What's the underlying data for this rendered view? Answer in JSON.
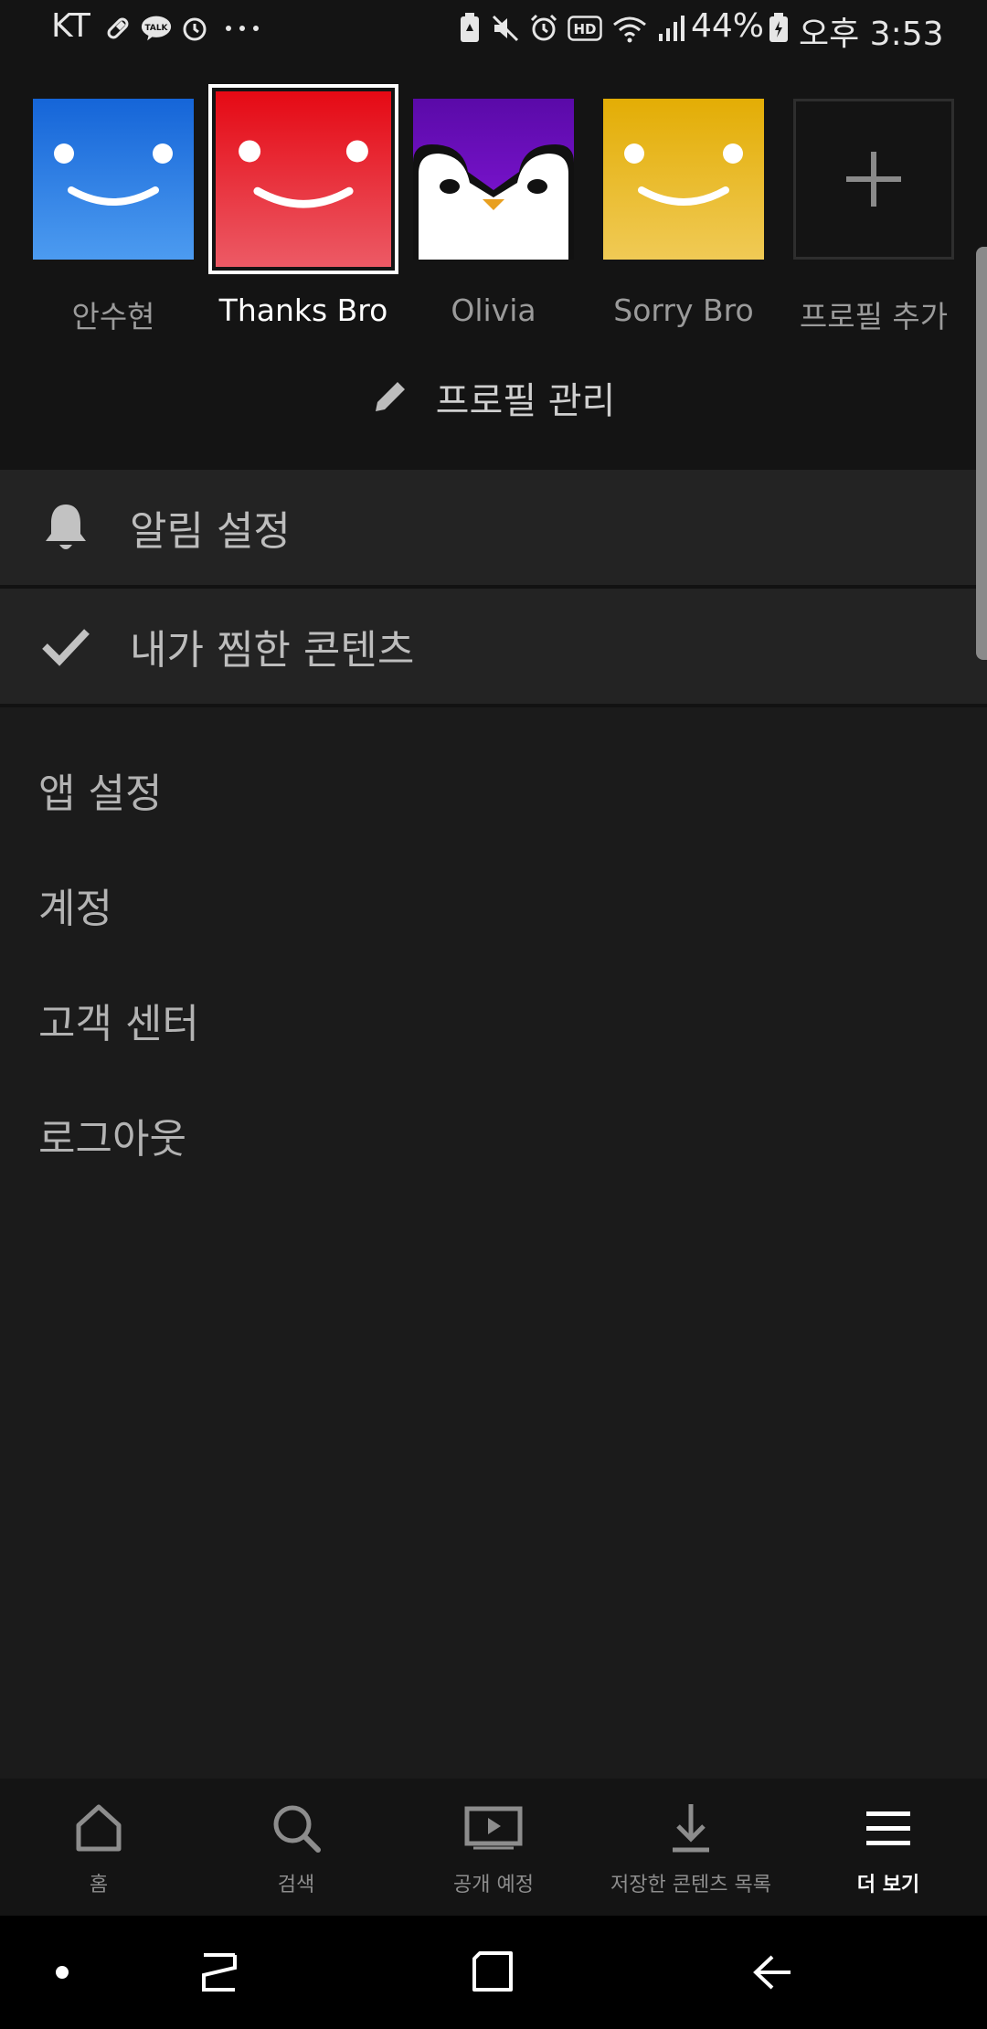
{
  "status_bar": {
    "carrier": "KT",
    "battery": "44%",
    "time": "오후 3:53",
    "left_icons": [
      "pill-icon",
      "kakaotalk-icon",
      "alarm-icon",
      "more-dots-icon"
    ],
    "right_icons": [
      "battery-saver-icon",
      "mute-icon",
      "alarm-icon",
      "hd-icon",
      "wifi-icon",
      "signal-icon",
      "battery-icon"
    ],
    "talk_label": "TALK",
    "hd_label": "HD"
  },
  "profiles": [
    {
      "name": "안수현",
      "color": "#1e7ee6",
      "type": "smiley"
    },
    {
      "name": "Thanks Bro",
      "color": "#e50914",
      "type": "smiley",
      "selected": true
    },
    {
      "name": "Olivia",
      "color": "#6a0dad",
      "type": "penguin"
    },
    {
      "name": "Sorry Bro",
      "color": "#e8b308",
      "type": "smiley"
    },
    {
      "name": "프로필 추가",
      "type": "add"
    }
  ],
  "manage_profiles": "프로필 관리",
  "menu_rows": [
    {
      "label": "알림 설정",
      "icon": "bell-icon"
    },
    {
      "label": "내가 찜한 콘텐츠",
      "icon": "checkmark-icon"
    }
  ],
  "plain_items": [
    "앱 설정",
    "계정",
    "고객 센터",
    "로그아웃"
  ],
  "tabs": [
    {
      "label": "홈",
      "icon": "home-icon"
    },
    {
      "label": "검색",
      "icon": "search-icon"
    },
    {
      "label": "공개 예정",
      "icon": "play-screen-icon"
    },
    {
      "label": "저장한 콘텐츠 목록",
      "icon": "download-icon"
    },
    {
      "label": "더 보기",
      "icon": "menu-icon",
      "active": true
    }
  ],
  "nav_buttons": [
    "nav-dot",
    "recent-apps",
    "home-square",
    "back-arrow"
  ],
  "colors": {
    "background": "#1b1b1b",
    "header": "#141414",
    "row": "#232323",
    "active_text": "#ffffff",
    "muted_text": "#8d8d8d"
  }
}
